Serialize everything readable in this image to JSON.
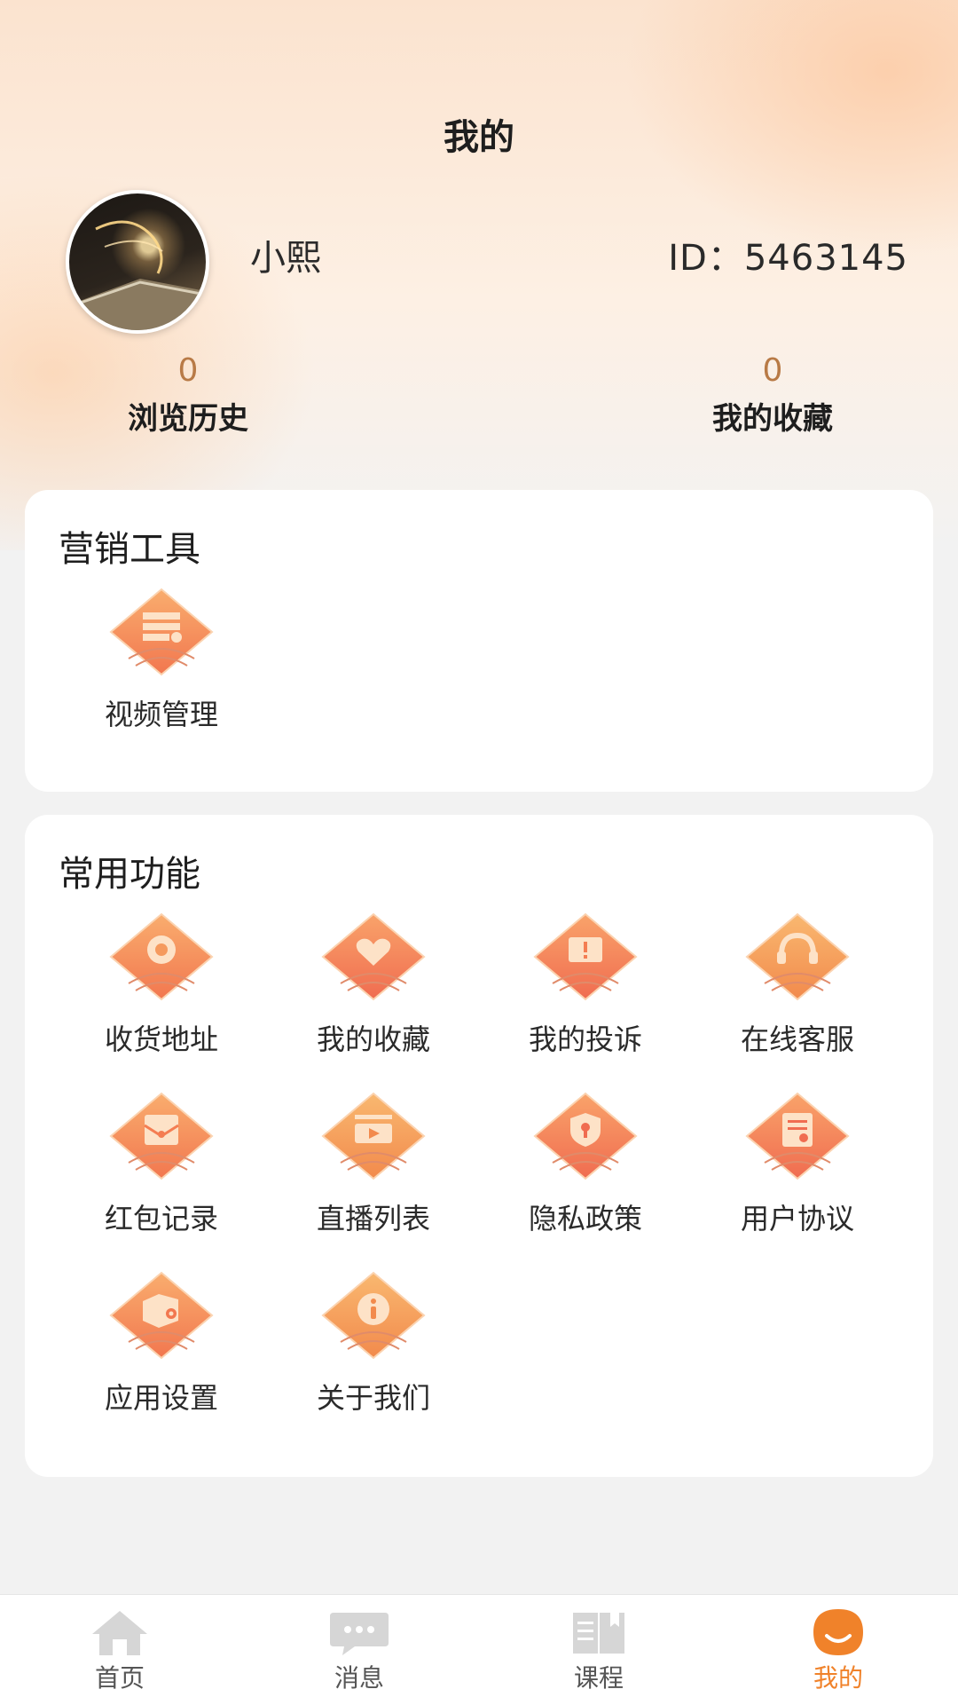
{
  "page": {
    "title": "我的"
  },
  "profile": {
    "name": "小熙",
    "id_text": "ID：5463145"
  },
  "stats": [
    {
      "value": "0",
      "label": "浏览历史"
    },
    {
      "value": "0",
      "label": "我的收藏"
    }
  ],
  "marketing": {
    "title": "营销工具",
    "items": [
      {
        "label": "视频管理",
        "icon": "video-manage-icon"
      }
    ]
  },
  "common": {
    "title": "常用功能",
    "items": [
      {
        "label": "收货地址",
        "icon": "location-pin-icon"
      },
      {
        "label": "我的收藏",
        "icon": "heart-icon"
      },
      {
        "label": "我的投诉",
        "icon": "complaint-icon"
      },
      {
        "label": "在线客服",
        "icon": "headset-icon"
      },
      {
        "label": "红包记录",
        "icon": "red-envelope-icon"
      },
      {
        "label": "直播列表",
        "icon": "live-stream-icon"
      },
      {
        "label": "隐私政策",
        "icon": "shield-icon"
      },
      {
        "label": "用户协议",
        "icon": "agreement-icon"
      },
      {
        "label": "应用设置",
        "icon": "settings-box-icon"
      },
      {
        "label": "关于我们",
        "icon": "info-icon"
      }
    ]
  },
  "tabbar": {
    "items": [
      {
        "label": "首页",
        "icon": "home-icon"
      },
      {
        "label": "消息",
        "icon": "message-icon"
      },
      {
        "label": "课程",
        "icon": "book-icon"
      },
      {
        "label": "我的",
        "icon": "user-icon",
        "active": true
      }
    ]
  },
  "colors": {
    "accent": "#f0822a",
    "tile_gradient_start": "#f9a96a",
    "tile_gradient_end": "#f47d52",
    "stat_number": "#b87a46"
  }
}
